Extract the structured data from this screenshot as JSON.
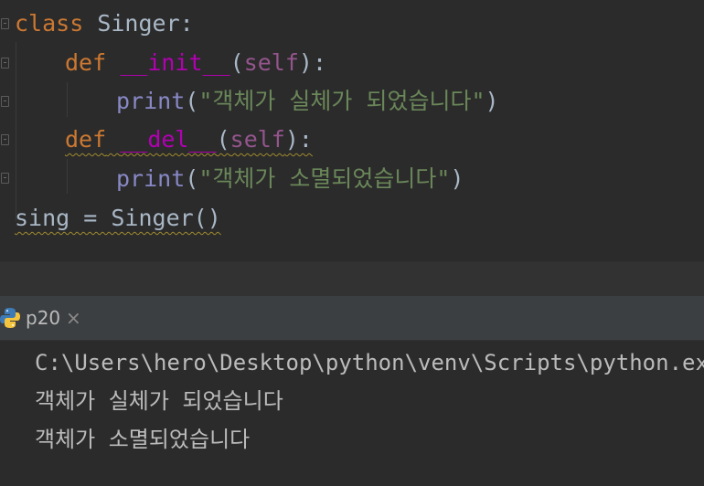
{
  "editor": {
    "lines": {
      "l1": {
        "kw": "class",
        "name": " Singer:"
      },
      "l2": {
        "kw": "def",
        "sp": " ",
        "method": "__init__",
        "open": "(",
        "self": "self",
        "close": "):"
      },
      "l3": {
        "func": "print",
        "open": "(",
        "str": "\"객체가 실체가 되었습니다\"",
        "close": ")"
      },
      "l4": {
        "kw": "def",
        "sp": " ",
        "method": "__del__",
        "open": "(",
        "self": "self",
        "close": "):"
      },
      "l5": {
        "func": "print",
        "open": "(",
        "str": "\"객체가 소멸되었습니다\"",
        "close": ")"
      },
      "l6": {
        "code": "sing = Singer()"
      }
    }
  },
  "run_panel": {
    "tab_label": "p20",
    "tab_close": "×",
    "icon": "python-icon",
    "output": [
      "C:\\Users\\hero\\Desktop\\python\\venv\\Scripts\\python.exe",
      "객체가 실체가 되었습니다",
      "객체가 소멸되었습니다"
    ]
  }
}
